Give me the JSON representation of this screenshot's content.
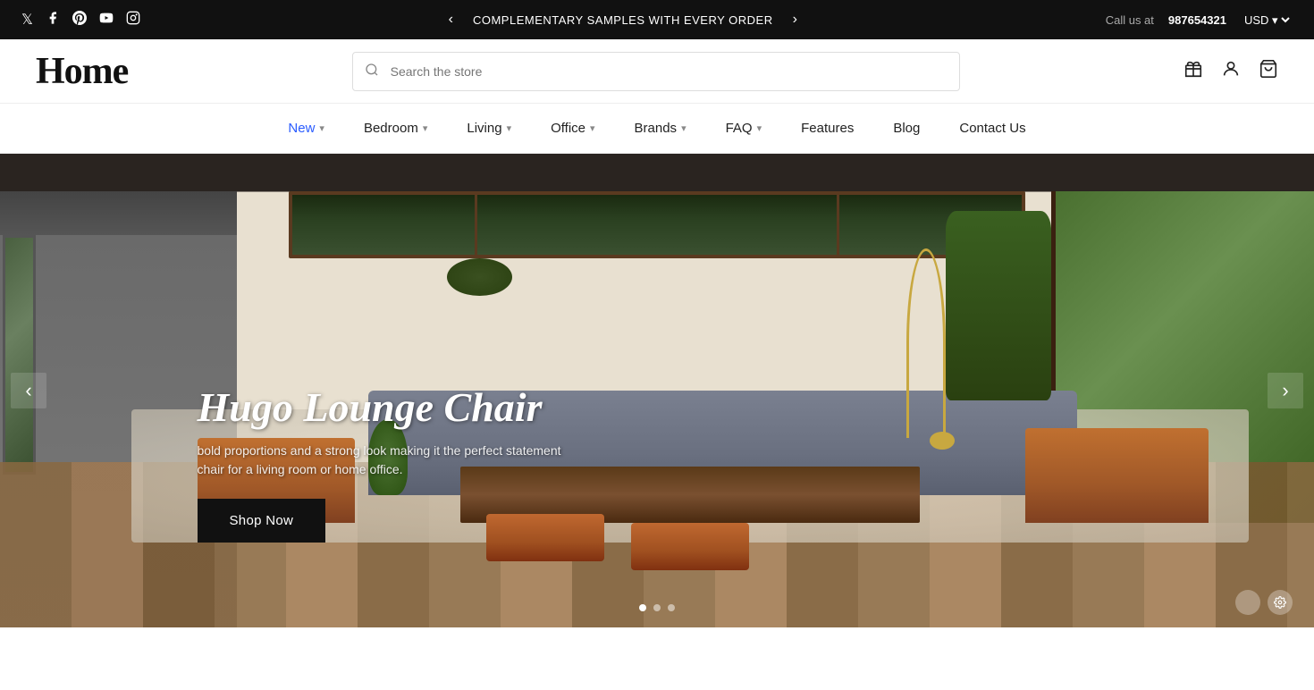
{
  "topbar": {
    "promo_text": "COMPLEMENTARY SAMPLES WITH EVERY ORDER",
    "call_label": "Call us at",
    "phone": "987654321",
    "currency": "USD",
    "prev_label": "‹",
    "next_label": "›"
  },
  "social_icons": [
    {
      "name": "x-icon",
      "symbol": "𝕏"
    },
    {
      "name": "facebook-icon",
      "symbol": "f"
    },
    {
      "name": "pinterest-icon",
      "symbol": "P"
    },
    {
      "name": "youtube-icon",
      "symbol": "▶"
    },
    {
      "name": "instagram-icon",
      "symbol": "◉"
    }
  ],
  "header": {
    "logo": "Home",
    "search_placeholder": "Search the store"
  },
  "nav": {
    "items": [
      {
        "label": "New",
        "has_dropdown": true,
        "active": true
      },
      {
        "label": "Bedroom",
        "has_dropdown": true,
        "active": false
      },
      {
        "label": "Living",
        "has_dropdown": true,
        "active": false
      },
      {
        "label": "Office",
        "has_dropdown": true,
        "active": false
      },
      {
        "label": "Brands",
        "has_dropdown": true,
        "active": false
      },
      {
        "label": "FAQ",
        "has_dropdown": true,
        "active": false
      },
      {
        "label": "Features",
        "has_dropdown": false,
        "active": false
      },
      {
        "label": "Blog",
        "has_dropdown": false,
        "active": false
      },
      {
        "label": "Contact Us",
        "has_dropdown": false,
        "active": false
      }
    ]
  },
  "hero": {
    "title": "Hugo Lounge Chair",
    "description": "bold proportions and a strong look making it the perfect statement chair for a living room or home office.",
    "cta_label": "Shop Now",
    "prev_arrow": "‹",
    "next_arrow": "›",
    "dots": [
      {
        "active": true
      },
      {
        "active": false
      },
      {
        "active": false
      }
    ]
  }
}
